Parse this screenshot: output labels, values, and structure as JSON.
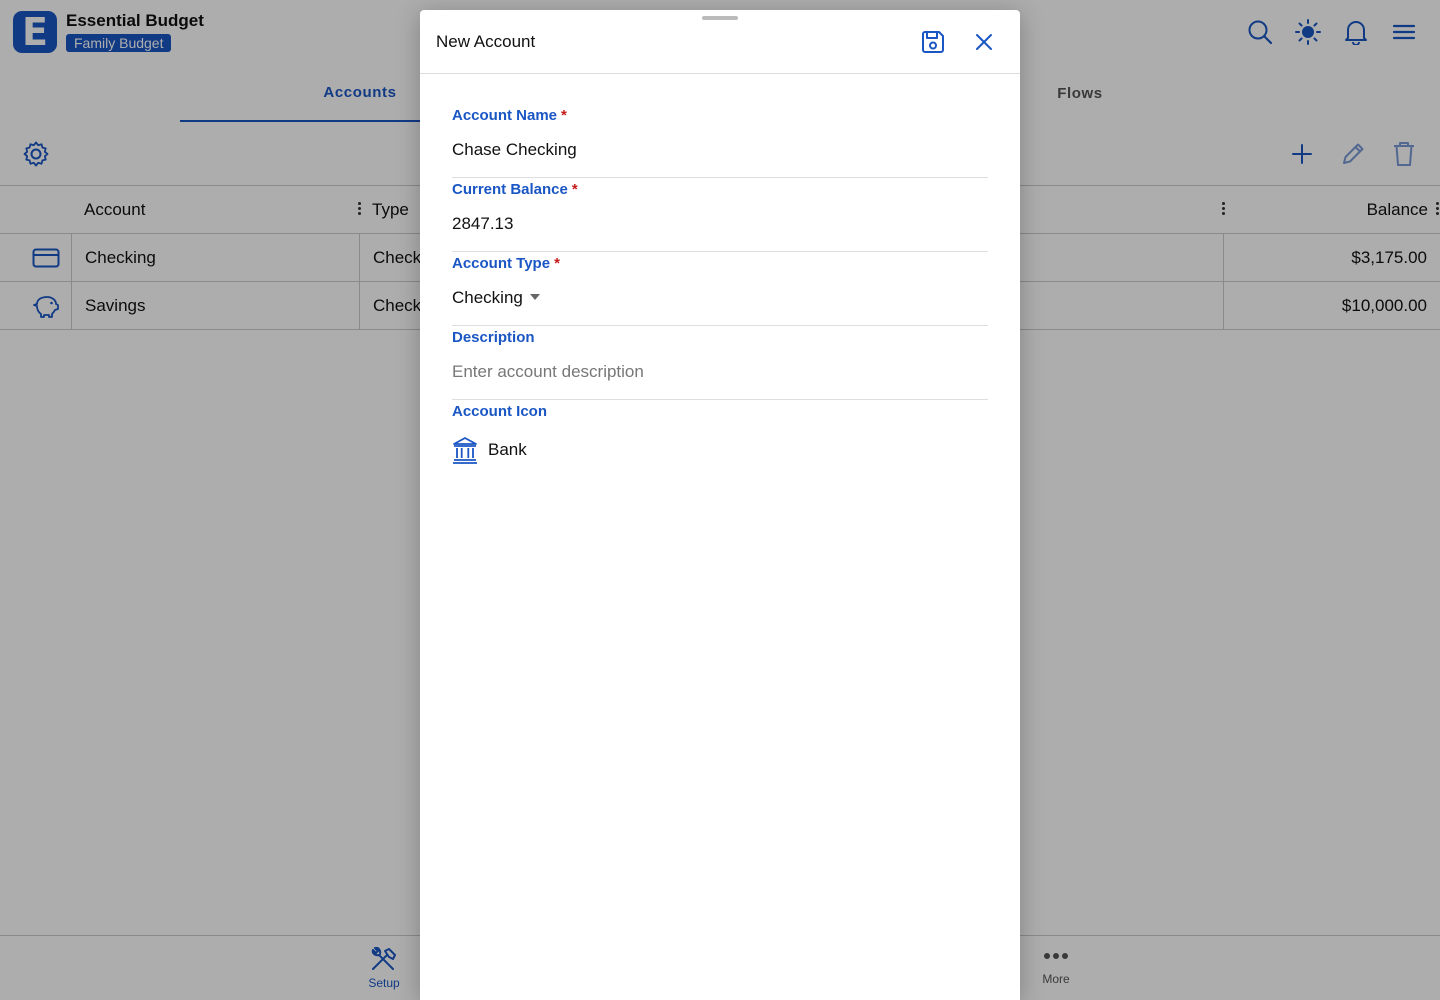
{
  "app": {
    "title": "Essential Budget",
    "logo_letter": "E",
    "budget_name": "Family Budget"
  },
  "topbar_icons": [
    "search-icon",
    "brightness-icon",
    "bell-icon",
    "menu-icon"
  ],
  "tabs": [
    {
      "label": "Accounts",
      "active": true
    },
    {
      "label": "Flows",
      "active": false
    }
  ],
  "toolbar": {
    "icons": [
      "gear-icon",
      "add-icon",
      "edit-icon",
      "delete-icon"
    ]
  },
  "grid": {
    "columns": {
      "account": "Account",
      "type": "Type",
      "balance": "Balance"
    },
    "rows": [
      {
        "icon": "credit-card-icon",
        "account": "Checking",
        "type": "Check",
        "balance": "$3,175.00"
      },
      {
        "icon": "piggy-bank-icon",
        "account": "Savings",
        "type": "Check",
        "balance": "$10,000.00"
      }
    ]
  },
  "bottom_nav": {
    "setup": "Setup",
    "more": "More"
  },
  "modal": {
    "title": "New Account",
    "fields": {
      "account_name": {
        "label": "Account Name",
        "required": "*",
        "value": "Chase Checking"
      },
      "current_balance": {
        "label": "Current Balance",
        "required": "*",
        "value": "2847.13"
      },
      "account_type": {
        "label": "Account Type",
        "required": "*",
        "value": "Checking"
      },
      "description": {
        "label": "Description",
        "placeholder": "Enter account description"
      },
      "account_icon": {
        "label": "Account Icon",
        "value": "Bank",
        "icon": "bank-icon"
      }
    }
  },
  "colors": {
    "accent": "#1a56c4",
    "required": "#c41a1a"
  }
}
